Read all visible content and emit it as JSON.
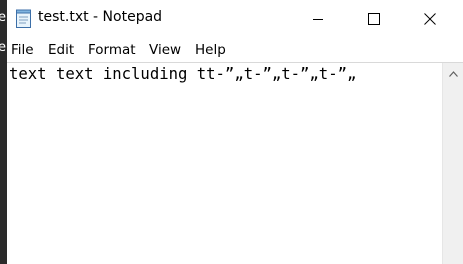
{
  "window": {
    "title": "test.txt - Notepad"
  },
  "menu": {
    "items": [
      "File",
      "Edit",
      "Format",
      "View",
      "Help"
    ]
  },
  "editor": {
    "content": "text text including tt-”„t-”„t-”„t-”„"
  },
  "desktop": {
    "edge_glyph": "e"
  },
  "icons": {
    "app": "notepad-icon",
    "minimize": "minimize-icon",
    "maximize": "maximize-icon",
    "close": "close-icon",
    "scroll_up": "chevron-up-icon"
  }
}
